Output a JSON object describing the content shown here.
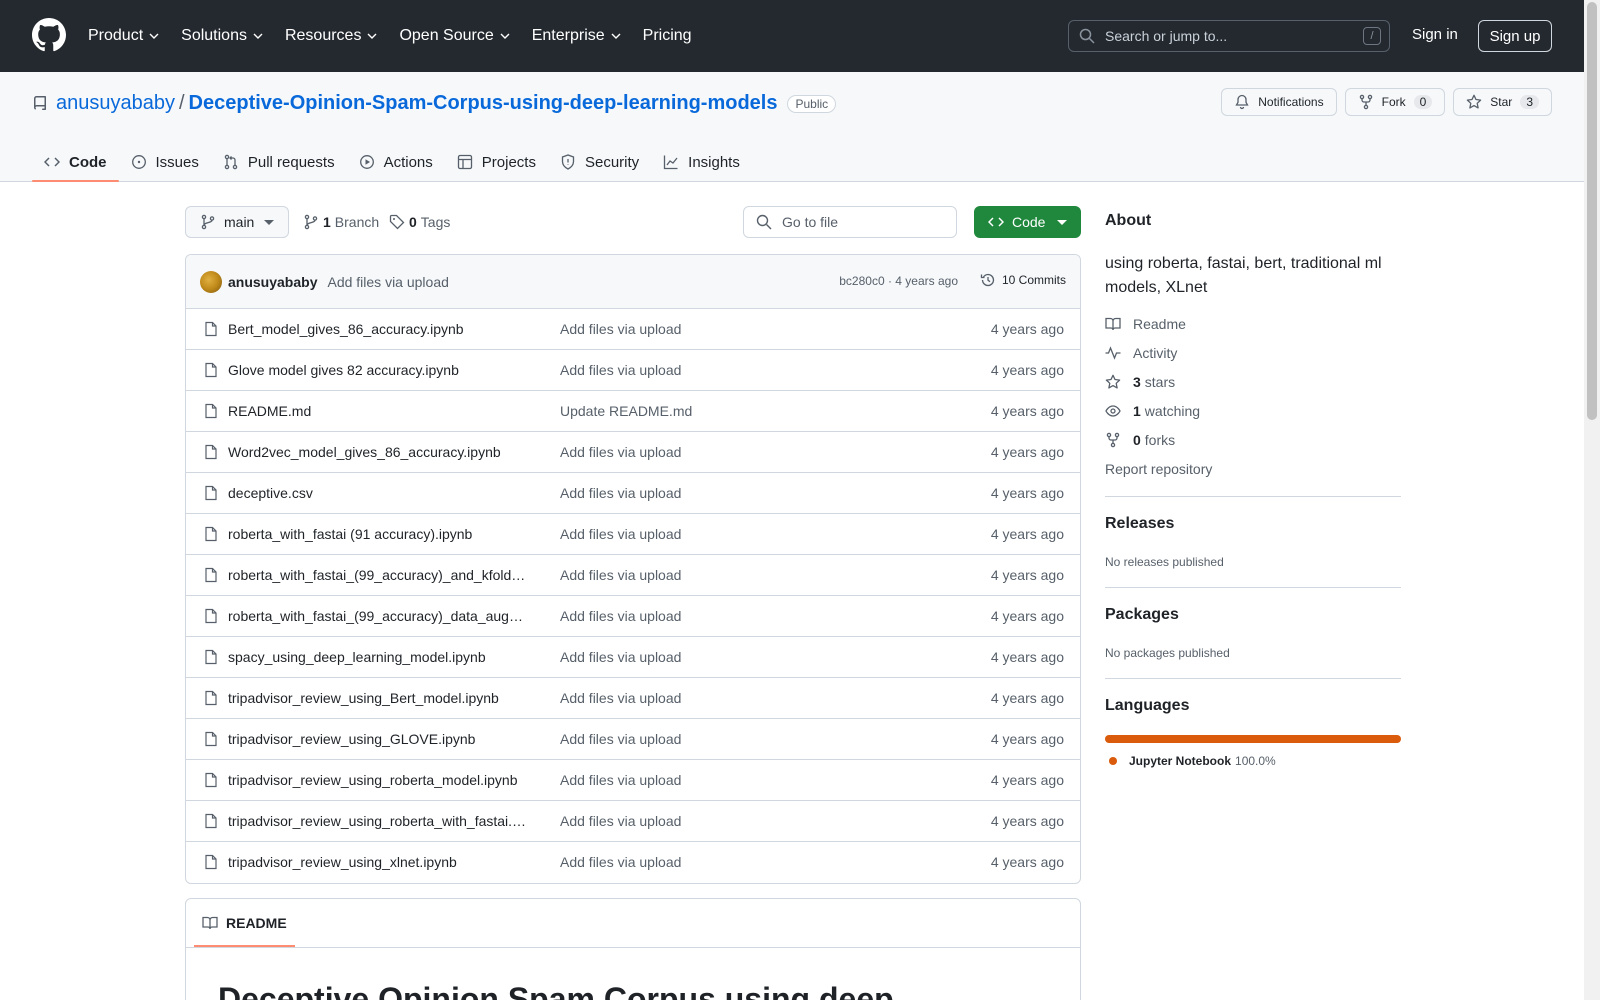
{
  "header": {
    "nav": [
      {
        "label": "Product",
        "dropdown": true
      },
      {
        "label": "Solutions",
        "dropdown": true
      },
      {
        "label": "Resources",
        "dropdown": true
      },
      {
        "label": "Open Source",
        "dropdown": true
      },
      {
        "label": "Enterprise",
        "dropdown": true
      },
      {
        "label": "Pricing",
        "dropdown": false
      }
    ],
    "search_placeholder": "Search or jump to...",
    "search_key": "/",
    "signin_label": "Sign in",
    "signup_label": "Sign up"
  },
  "repo": {
    "owner": "anusuyababy",
    "separator": "/",
    "name": "Deceptive-Opinion-Spam-Corpus-using-deep-learning-models",
    "visibility": "Public",
    "notifications_label": "Notifications",
    "fork_label": "Fork",
    "fork_count": "0",
    "star_label": "Star",
    "star_count": "3",
    "tabs": [
      {
        "label": "Code",
        "icon": "code-icon",
        "active": true
      },
      {
        "label": "Issues",
        "icon": "issue-icon",
        "active": false
      },
      {
        "label": "Pull requests",
        "icon": "pull-request-icon",
        "active": false
      },
      {
        "label": "Actions",
        "icon": "play-icon",
        "active": false
      },
      {
        "label": "Projects",
        "icon": "table-icon",
        "active": false
      },
      {
        "label": "Security",
        "icon": "shield-icon",
        "active": false
      },
      {
        "label": "Insights",
        "icon": "graph-icon",
        "active": false
      }
    ]
  },
  "toolbar": {
    "branch": "main",
    "branch_count": "1",
    "branch_label": "Branch",
    "tag_count": "0",
    "tag_label": "Tags",
    "goto_placeholder": "Go to file",
    "code_label": "Code"
  },
  "latest_commit": {
    "author": "anusuyababy",
    "message": "Add files via upload",
    "meta": "bc280c0 · 4 years ago",
    "commits_label": "10 Commits"
  },
  "files": [
    {
      "name": "Bert_model_gives_86_accuracy.ipynb",
      "message": "Add files via upload",
      "time": "4 years ago"
    },
    {
      "name": "Glove model gives 82 accuracy.ipynb",
      "message": "Add files via upload",
      "time": "4 years ago"
    },
    {
      "name": "README.md",
      "message": "Update README.md",
      "time": "4 years ago"
    },
    {
      "name": "Word2vec_model_gives_86_accuracy.ipynb",
      "message": "Add files via upload",
      "time": "4 years ago"
    },
    {
      "name": "deceptive.csv",
      "message": "Add files via upload",
      "time": "4 years ago"
    },
    {
      "name": "roberta_with_fastai (91 accuracy).ipynb",
      "message": "Add files via upload",
      "time": "4 years ago"
    },
    {
      "name": "roberta_with_fastai_(99_accuracy)_and_kfold…",
      "message": "Add files via upload",
      "time": "4 years ago"
    },
    {
      "name": "roberta_with_fastai_(99_accuracy)_data_aug…",
      "message": "Add files via upload",
      "time": "4 years ago"
    },
    {
      "name": "spacy_using_deep_learning_model.ipynb",
      "message": "Add files via upload",
      "time": "4 years ago"
    },
    {
      "name": "tripadvisor_review_using_Bert_model.ipynb",
      "message": "Add files via upload",
      "time": "4 years ago"
    },
    {
      "name": "tripadvisor_review_using_GLOVE.ipynb",
      "message": "Add files via upload",
      "time": "4 years ago"
    },
    {
      "name": "tripadvisor_review_using_roberta_model.ipynb",
      "message": "Add files via upload",
      "time": "4 years ago"
    },
    {
      "name": "tripadvisor_review_using_roberta_with_fastai.…",
      "message": "Add files via upload",
      "time": "4 years ago"
    },
    {
      "name": "tripadvisor_review_using_xlnet.ipynb",
      "message": "Add files via upload",
      "time": "4 years ago"
    }
  ],
  "readme": {
    "tab_label": "README",
    "heading": "Deceptive Opinion Spam Corpus using deep"
  },
  "sidebar": {
    "about_title": "About",
    "description": "using roberta, fastai, bert, traditional ml models, XLnet",
    "readme_label": "Readme",
    "activity_label": "Activity",
    "stars_count": "3",
    "stars_label": "stars",
    "watching_count": "1",
    "watching_label": "watching",
    "forks_count": "0",
    "forks_label": "forks",
    "report_label": "Report repository",
    "releases_title": "Releases",
    "releases_empty": "No releases published",
    "packages_title": "Packages",
    "packages_empty": "No packages published",
    "languages_title": "Languages",
    "language_name": "Jupyter Notebook",
    "language_pct": "100.0%",
    "language_color": "#da5b0b"
  }
}
